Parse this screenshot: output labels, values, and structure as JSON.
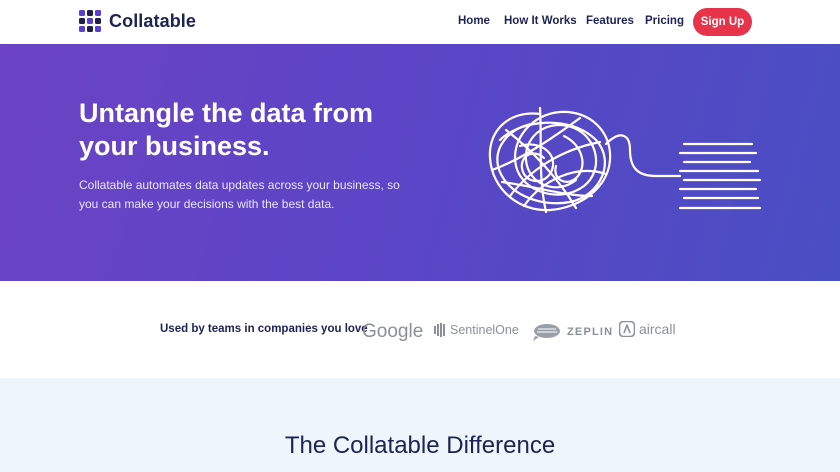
{
  "brand": {
    "name": "Collatable",
    "accent": "#5a3fd3",
    "dark": "#1c2355",
    "cta_color": "#e8344a"
  },
  "nav": {
    "items": [
      {
        "label": "Home"
      },
      {
        "label": "How It Works"
      },
      {
        "label": "Features"
      },
      {
        "label": "Pricing"
      }
    ],
    "signup_label": "Sign Up"
  },
  "hero": {
    "title": "Untangle the data from your business.",
    "subtitle": "Collatable automates data updates across your business, so you can make your decisions with the best data.",
    "gradient": [
      "#6b43c4",
      "#4a4ec3"
    ],
    "illustration": "tangled-line-to-lines"
  },
  "logos": {
    "label": "Used by teams in companies you love",
    "companies": [
      {
        "name": "Google",
        "icon": "google-logo"
      },
      {
        "name": "SentinelOne",
        "icon": "sentinelone-logo"
      },
      {
        "name": "ZEPLIN",
        "icon": "zeplin-logo"
      },
      {
        "name": "aircall",
        "icon": "aircall-logo"
      }
    ]
  },
  "difference": {
    "title": "The Collatable Difference"
  }
}
